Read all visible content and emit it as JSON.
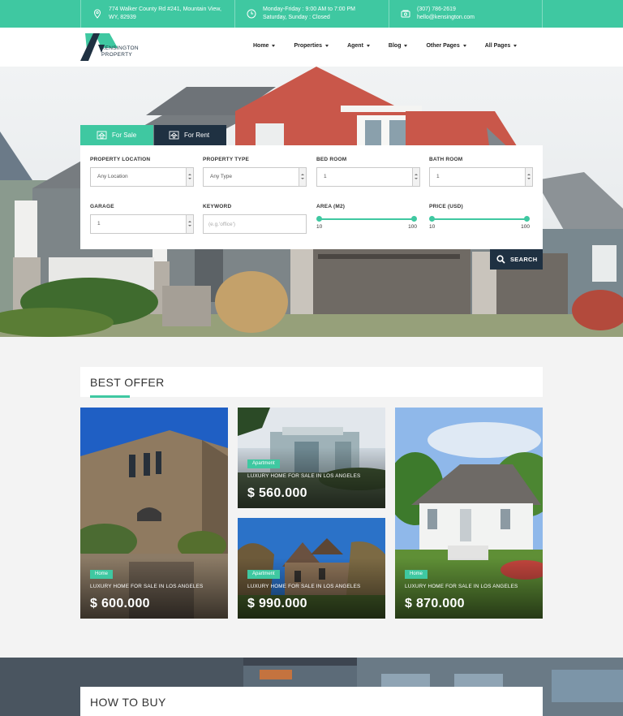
{
  "topbar": {
    "address_line1": "774 Walker County Rd #241, Mountain View,",
    "address_line2": "WY, 82939",
    "hours_line1": "Monday-Friday : 9:00 AM to 7:00 PM",
    "hours_line2": "Saturday, Sunday : Closed",
    "phone": "(307) 786-2619",
    "email": "hello@kensington.com"
  },
  "brand": {
    "line1": "KENSINGTON",
    "line2": "PROPERTY",
    "accent": "#3fc8a1",
    "dark": "#1f3142"
  },
  "nav": [
    "Home",
    "Properties",
    "Agent",
    "Blog",
    "Other Pages",
    "All Pages"
  ],
  "tabs": {
    "sale": "For Sale",
    "rent": "For Rent"
  },
  "search": {
    "location_label": "PROPERTY LOCATION",
    "location_value": "Any Location",
    "type_label": "PROPERTY TYPE",
    "type_value": "Any Type",
    "bed_label": "BED ROOM",
    "bed_value": "1",
    "bath_label": "BATH ROOM",
    "bath_value": "1",
    "garage_label": "GARAGE",
    "garage_value": "1",
    "keyword_label": "KEYWORD",
    "keyword_placeholder": "(e.g.'office')",
    "area_label": "AREA (M2)",
    "area_min": "10",
    "area_max": "100",
    "price_label": "PRICE (USD)",
    "price_min": "10",
    "price_max": "100",
    "button": "SEARCH"
  },
  "best_offer": {
    "title": "BEST OFFER",
    "cards": [
      {
        "badge": "Home",
        "title": "LUXURY HOME FOR SALE IN LOS ANGELES",
        "price": "$ 600.000"
      },
      {
        "badge": "Apartment",
        "title": "LUXURY HOME FOR SALE IN LOS ANGELES",
        "price": "$ 560.000"
      },
      {
        "badge": "Apartment",
        "title": "LUXURY HOME FOR SALE IN LOS ANGELES",
        "price": "$ 990.000"
      },
      {
        "badge": "Home",
        "title": "LUXURY HOME FOR SALE IN LOS ANGELES",
        "price": "$ 870.000"
      }
    ]
  },
  "how_to_buy": {
    "title": "HOW TO BUY"
  }
}
